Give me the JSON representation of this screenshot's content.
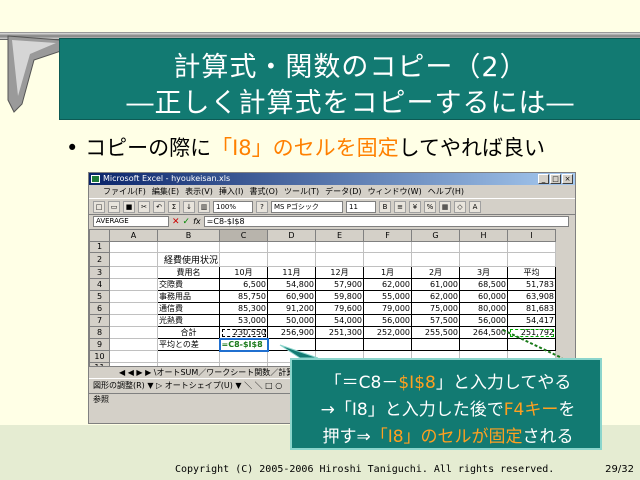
{
  "slide": {
    "title_line1": "計算式・関数のコピー（2）",
    "title_line2": "―正しく計算式をコピーするには―",
    "bullet_prefix": "コピーの際に",
    "bullet_highlight": "「I8」のセルを固定",
    "bullet_suffix": "してやれば良い",
    "callout": {
      "line1_prefix": "「＝C8－",
      "line1_highlight": "$I$8",
      "line1_suffix": "」と入力してやる",
      "line2_prefix": "→「I8」と入力した後で",
      "line2_highlight": "F4キー",
      "line2_suffix": "を",
      "line3_prefix": "押す⇒",
      "line3_highlight": "「I8」のセルが固定",
      "line3_suffix": "される"
    },
    "footer": "Copyright (C) 2005-2006 Hiroshi Taniguchi. All rights reserved.",
    "page_number": "29/32",
    "colors": {
      "title_bg": "#127a72",
      "highlight": "#ff8000",
      "callout_bg": "#127a72",
      "page_bg": "#ffffe6"
    }
  },
  "excel": {
    "window_title": "Microsoft Excel - hyoukeisan.xls",
    "menu": [
      "ファイル(F)",
      "編集(E)",
      "表示(V)",
      "挿入(I)",
      "書式(O)",
      "ツール(T)",
      "データ(D)",
      "ウィンドウ(W)",
      "ヘルプ(H)"
    ],
    "toolbar": {
      "zoom": "100%",
      "font": "MS Pゴシック",
      "font_size": "11"
    },
    "name_box": "AVERAGE",
    "formula": "=C8-$I$8",
    "columns": [
      "A",
      "B",
      "C",
      "D",
      "E",
      "F",
      "G",
      "H",
      "I"
    ],
    "row_numbers": [
      "1",
      "2",
      "3",
      "4",
      "5",
      "6",
      "7",
      "8",
      "9",
      "10",
      "11"
    ],
    "sheet_title": "経費使用状況",
    "header_row": [
      "費用名",
      "10月",
      "11月",
      "12月",
      "1月",
      "2月",
      "3月",
      "平均"
    ],
    "rows": [
      [
        "交際費",
        "6,500",
        "54,800",
        "57,900",
        "62,000",
        "61,000",
        "68,500",
        "51,783"
      ],
      [
        "事務用品",
        "85,750",
        "60,900",
        "59,800",
        "55,000",
        "62,000",
        "60,000",
        "63,908"
      ],
      [
        "通信費",
        "85,300",
        "91,200",
        "79,600",
        "79,000",
        "75,000",
        "80,000",
        "81,683"
      ],
      [
        "光熱費",
        "53,000",
        "50,000",
        "54,000",
        "56,000",
        "57,500",
        "56,000",
        "54,417"
      ],
      [
        "合計",
        "230,550",
        "256,900",
        "251,300",
        "252,000",
        "255,500",
        "264,500",
        "251,792"
      ]
    ],
    "row9_label": "平均との差",
    "row9_edit": "=C8-$I$8",
    "sheet_tabs": "◀ ◀ ▶ ▶ \\オートSUM／ワークシート関数／計算式・関",
    "drawing_toolbar": "図形の調整(R) ▼  ▷  オートシェイプ(U) ▼  ＼ ＼ □ ○",
    "status": "参照"
  }
}
